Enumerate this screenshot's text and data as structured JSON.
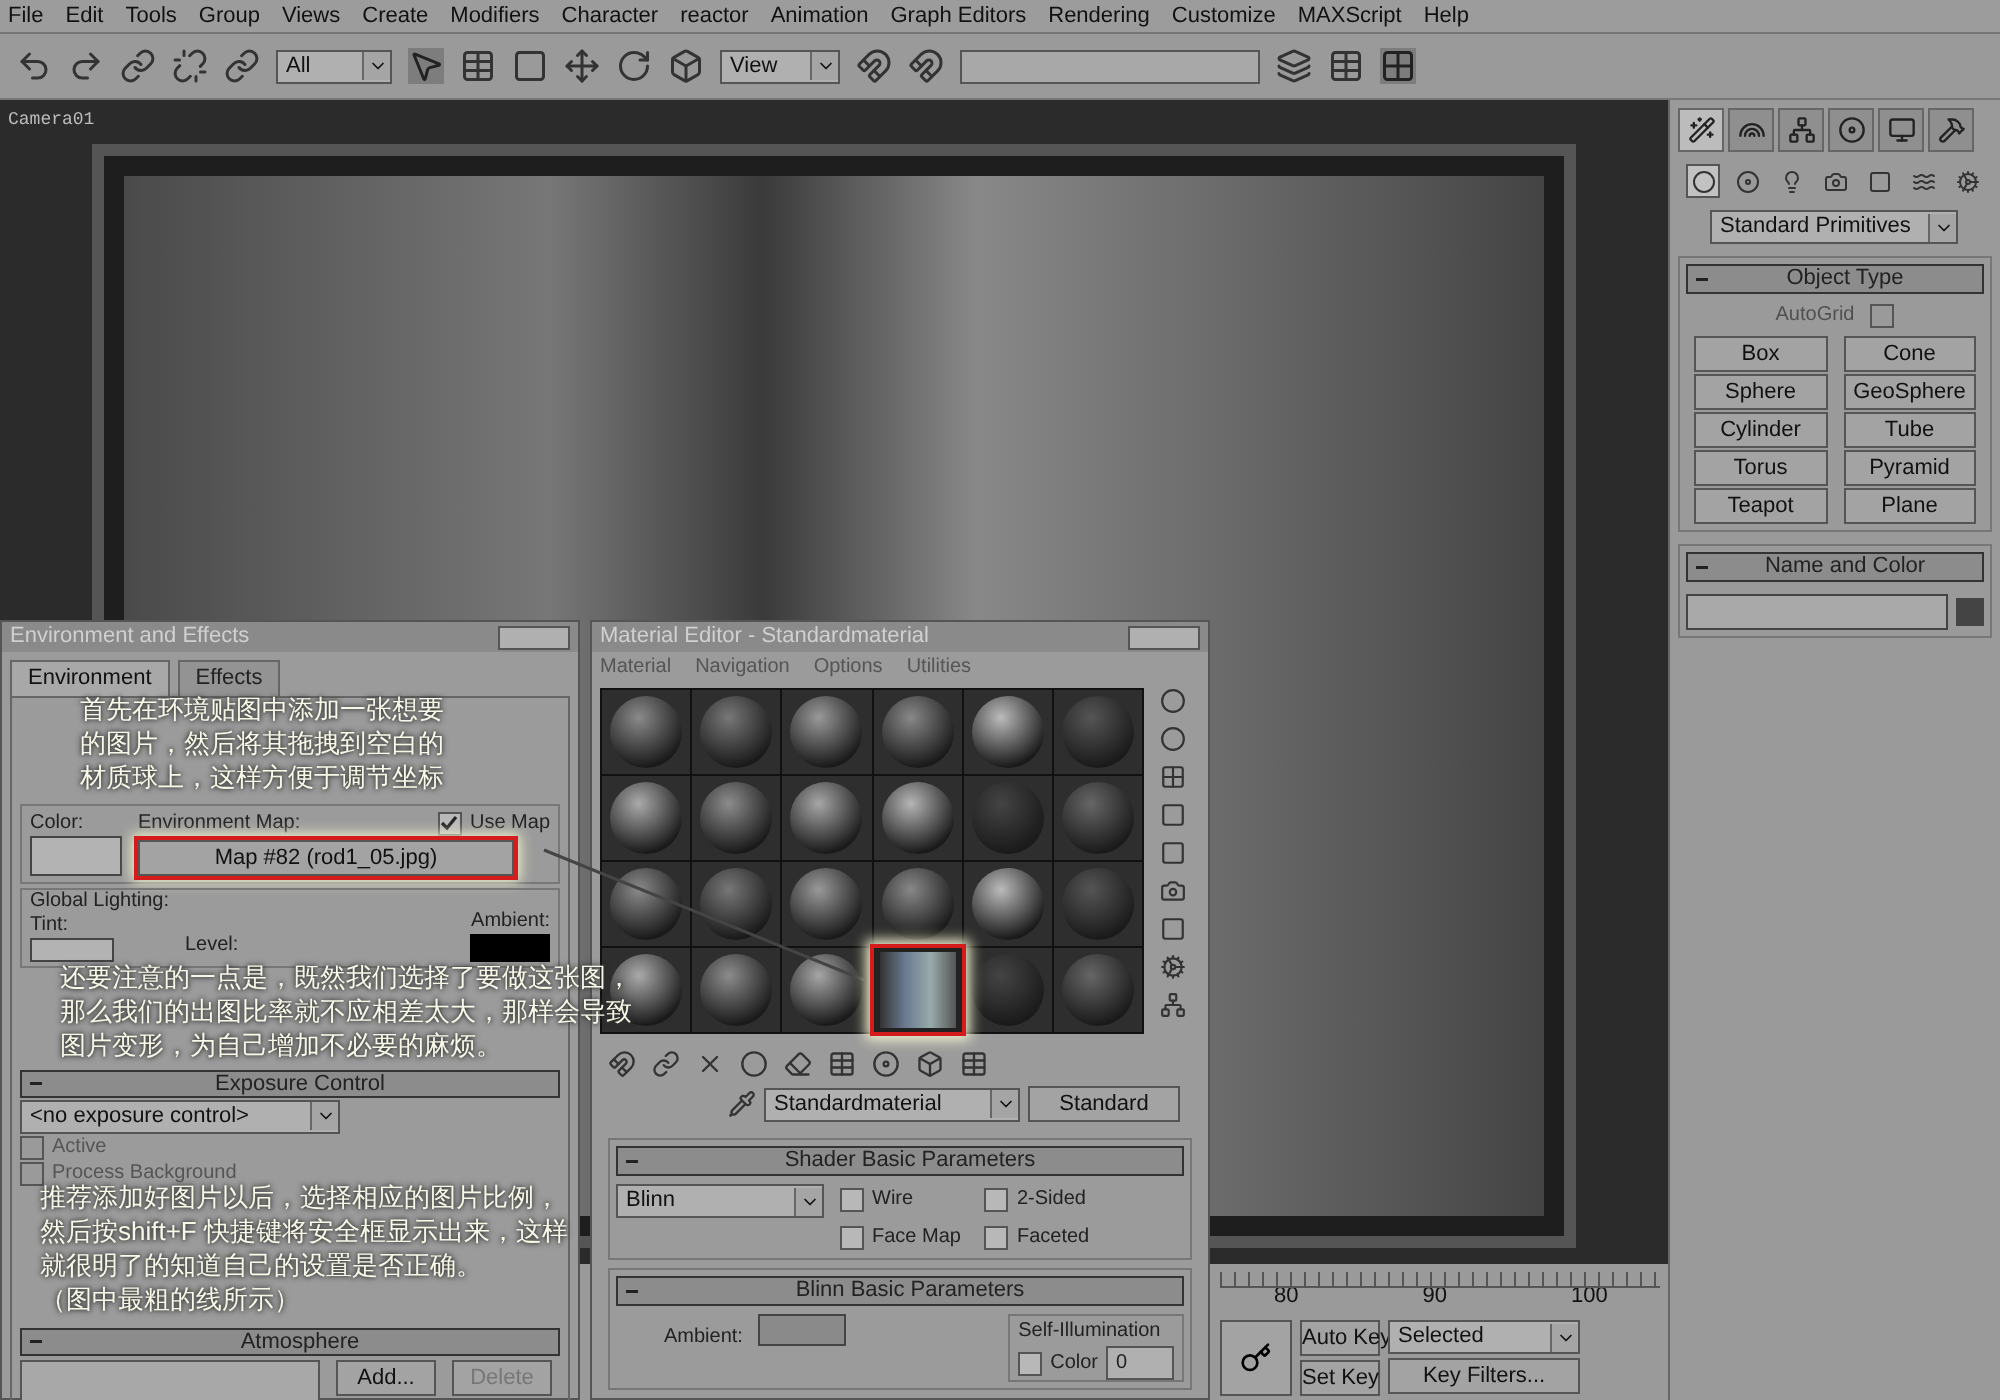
{
  "menu_bar": [
    "File",
    "Edit",
    "Tools",
    "Group",
    "Views",
    "Create",
    "Modifiers",
    "Character",
    "reactor",
    "Animation",
    "Graph Editors",
    "Rendering",
    "Customize",
    "MAXScript",
    "Help"
  ],
  "toolbar": {
    "selection_filter": "All",
    "reference_coord": "View"
  },
  "viewport": {
    "label": "Camera01"
  },
  "command_panel": {
    "tabs": [
      {
        "selected": true
      },
      {
        "selected": false
      },
      {
        "selected": false
      },
      {
        "selected": false
      },
      {
        "selected": false
      },
      {
        "selected": false
      }
    ],
    "categories": [
      {
        "selected": true
      },
      {
        "selected": false
      },
      {
        "selected": false
      },
      {
        "selected": false
      },
      {
        "selected": false
      },
      {
        "selected": false
      },
      {
        "selected": false
      }
    ],
    "dropdown": "Standard Primitives",
    "object_type": {
      "title": "Object Type",
      "autogrid": {
        "label": "AutoGrid",
        "checked": false
      },
      "buttons": [
        "Box",
        "Cone",
        "Sphere",
        "GeoSphere",
        "Cylinder",
        "Tube",
        "Torus",
        "Pyramid",
        "Teapot",
        "Plane"
      ]
    },
    "name_and_color": {
      "title": "Name and Color"
    }
  },
  "environment_dialog": {
    "title": "Environment and Effects",
    "tabs": [
      {
        "label": "Environment",
        "selected": true
      },
      {
        "label": "Effects",
        "selected": false
      }
    ],
    "color_label": "Color:",
    "environment_map_label": "Environment Map:",
    "use_map": {
      "label": "Use Map",
      "checked": true
    },
    "map_button": "Map #82 (rod1_05.jpg)",
    "global_lighting": "Global Lighting:",
    "tint_label": "Tint:",
    "level_label": "Level:",
    "ambient_label": "Ambient:",
    "exposure_title": "Exposure Control",
    "exposure_dropdown": "<no exposure control>",
    "checkboxes": [
      {
        "label": "Active",
        "checked": false
      },
      {
        "label": "Process Background",
        "checked": false
      }
    ],
    "atmosphere_title": "Atmosphere",
    "add_button": "Add...",
    "delete_button": {
      "label": "Delete",
      "disabled": true
    }
  },
  "material_editor": {
    "title": "Material Editor - Standardmaterial",
    "menu": [
      "Material",
      "Navigation",
      "Options",
      "Utilities"
    ],
    "slots": [
      {
        "selected": false
      },
      {
        "selected": false
      },
      {
        "selected": false
      },
      {
        "selected": false
      },
      {
        "selected": false
      },
      {
        "selected": false
      },
      {
        "selected": false
      },
      {
        "selected": false
      },
      {
        "selected": false
      },
      {
        "selected": false
      },
      {
        "selected": false
      },
      {
        "selected": false
      },
      {
        "selected": false
      },
      {
        "selected": false
      },
      {
        "selected": false
      },
      {
        "selected": false
      },
      {
        "selected": false
      },
      {
        "selected": false
      },
      {
        "selected": false
      },
      {
        "selected": false
      },
      {
        "selected": false
      },
      {
        "selected": true
      },
      {
        "selected": false
      },
      {
        "selected": false
      }
    ],
    "material_name": "Standardmaterial",
    "type_button": "Standard",
    "shader_title": "Shader Basic Parameters",
    "shader": "Blinn",
    "options": [
      {
        "label": "Wire",
        "checked": false
      },
      {
        "label": "2-Sided",
        "checked": false
      },
      {
        "label": "Face Map",
        "checked": false
      },
      {
        "label": "Faceted",
        "checked": false
      }
    ],
    "blinn_title": "Blinn Basic Parameters",
    "ambient_label": "Ambient:",
    "self_illumination": "Self-Illumination",
    "color_option": {
      "label": "Color",
      "checked": false
    },
    "color_value": "0"
  },
  "timeline": {
    "ticks": [
      "80",
      "90",
      "100"
    ],
    "auto_key": "Auto Key",
    "set_key": "Set Key",
    "key_mode": "Selected",
    "key_filters": "Key Filters..."
  },
  "annotations": [
    {
      "lines": [
        "首先在环境贴图中添加一张想要",
        "的图片，然后将其拖拽到空白的",
        "材质球上，这样方便于调节坐标"
      ]
    },
    {
      "lines": [
        "还要注意的一点是，既然我们选择了要做这张图，",
        "那么我们的出图比率就不应相差太大，那样会导致",
        "图片变形，为自己增加不必要的麻烦。"
      ]
    },
    {
      "lines": [
        "推荐添加好图片以后，选择相应的图片比例，",
        "然后按shift+F 快捷键将安全框显示出来，这样",
        "就很明了的知道自己的设置是否正确。",
        "（图中最粗的线所示）"
      ]
    }
  ]
}
